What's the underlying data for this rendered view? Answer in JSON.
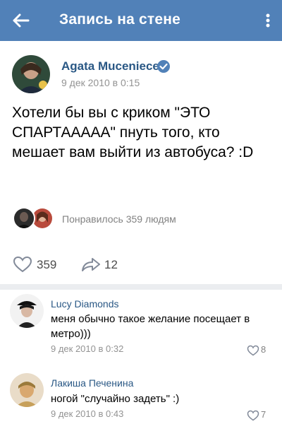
{
  "header": {
    "title": "Запись на стене"
  },
  "post": {
    "author": "Agata Muceniece",
    "date": "9 дек 2010 в 0:15",
    "text": "Хотели бы вы с криком \"ЭТО СПАРТААААА\" пнуть того, кто мешает вам выйти из автобуса? :D",
    "likes_text": "Понравилось 359 людям",
    "like_count": "359",
    "share_count": "12"
  },
  "comments": [
    {
      "author": "Lucy Diamonds",
      "text": "меня обычно такое желание посещает в метро)))",
      "date": "9 дек 2010 в 0:32",
      "likes": "8"
    },
    {
      "author": "Лакиша Печенина",
      "text": "ногой \"случайно задеть\" :)",
      "date": "9 дек 2010 в 0:43",
      "likes": "7"
    }
  ],
  "colors": {
    "header_bg": "#5181b8",
    "link": "#2a5885",
    "secondary_text": "#939393",
    "verified": "#5181b8"
  },
  "icons": [
    "back-arrow-icon",
    "more-vertical-icon",
    "verified-icon",
    "heart-icon",
    "share-arrow-icon"
  ]
}
